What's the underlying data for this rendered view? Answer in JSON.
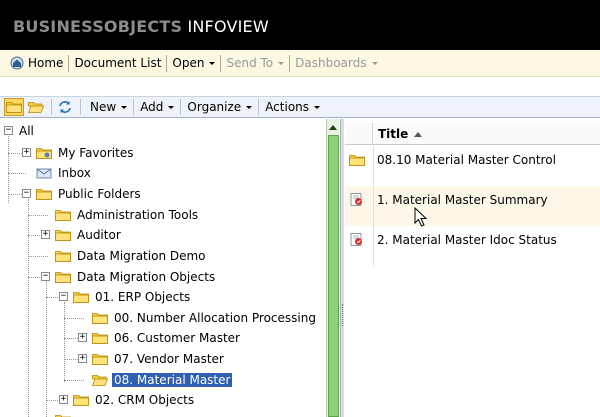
{
  "banner": {
    "brand_part1": "BUSINESSOBJECTS",
    "brand_part2": "INFOVIEW"
  },
  "menubar": {
    "home": "Home",
    "document_list": "Document List",
    "open": "Open",
    "send_to": "Send To",
    "dashboards": "Dashboards"
  },
  "toolbar": {
    "new": "New",
    "add": "Add",
    "organize": "Organize",
    "actions": "Actions"
  },
  "tree": {
    "all": "All",
    "my_favorites": "My Favorites",
    "inbox": "Inbox",
    "public_folders": "Public Folders",
    "administration_tools": "Administration Tools",
    "auditor": "Auditor",
    "data_migration_demo": "Data Migration Demo",
    "data_migration_objects": "Data Migration Objects",
    "erp_objects": "01. ERP Objects",
    "number_allocation": "00. Number Allocation Processing",
    "customer_master": "06. Customer Master",
    "vendor_master": "07. Vendor Master",
    "material_master": "08. Material Master",
    "crm_objects": "02. CRM Objects"
  },
  "list": {
    "column_title": "Title",
    "rows": [
      {
        "title": "08.10 Material Master Control",
        "type": "folder-icon"
      },
      {
        "title": "1. Material Master Summary",
        "type": "report-icon"
      },
      {
        "title": "2. Material Master Idoc Status",
        "type": "report-icon"
      }
    ]
  },
  "colors": {
    "banner_bg": "#000000",
    "menubar_bg": "#fdf8e2",
    "selection": "#2e5fb2",
    "scrollbar_thumb": "#8fcf7a"
  }
}
